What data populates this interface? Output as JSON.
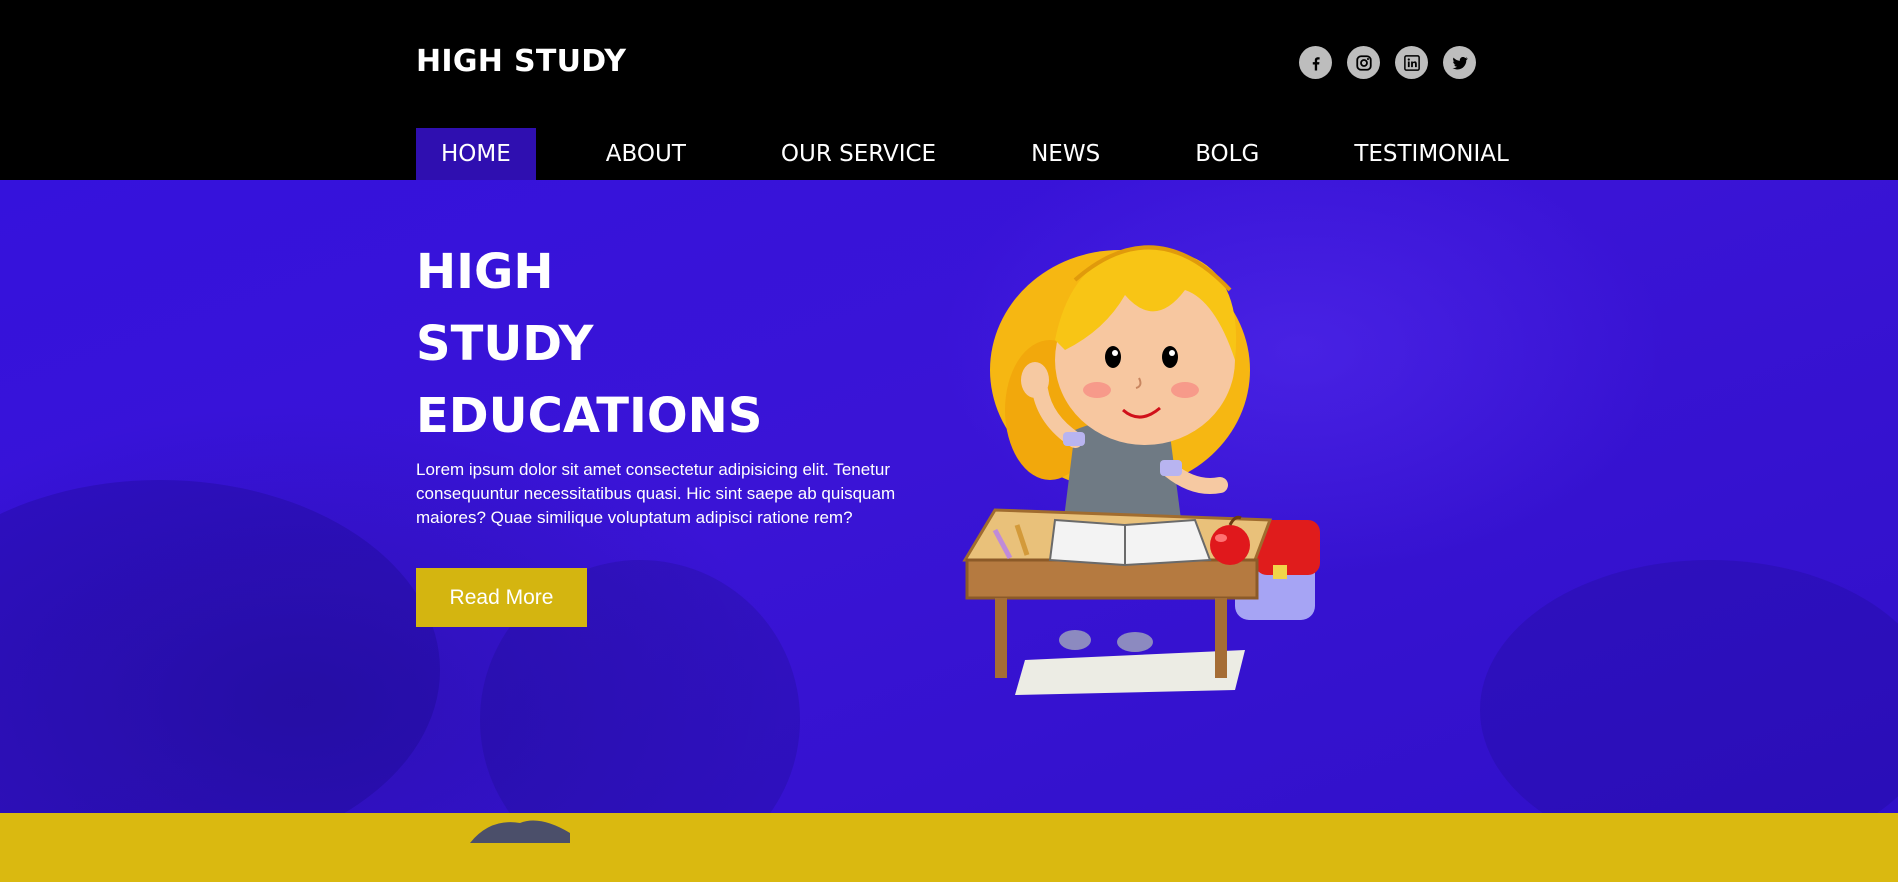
{
  "header": {
    "logo": "HIGH STUDY",
    "socials": [
      {
        "name": "facebook-icon"
      },
      {
        "name": "instagram-icon"
      },
      {
        "name": "linkedin-icon"
      },
      {
        "name": "twitter-icon"
      }
    ]
  },
  "nav": {
    "items": [
      {
        "label": "HOME",
        "active": true
      },
      {
        "label": "ABOUT"
      },
      {
        "label": "OUR SERVICE"
      },
      {
        "label": "NEWS"
      },
      {
        "label": "BOLG"
      },
      {
        "label": "TESTIMONIAL"
      }
    ]
  },
  "hero": {
    "title_lines": [
      "HIGH",
      "STUDY",
      "EDUCATIONS"
    ],
    "text": "Lorem ipsum dolor sit amet consectetur adipisicing elit. Tenetur consequuntur necessitatibus quasi. Hic sint saepe ab quisquam maiores? Quae similique voluptatum adipisci ratione rem?",
    "button": "Read More"
  },
  "colors": {
    "header_bg": "#000000",
    "nav_active_bg": "#2f0fb0",
    "hero_bg": "#3512dc",
    "button_bg": "#d4b510",
    "band_bg": "#dab910",
    "social_icon_bg": "#bdbdbd"
  }
}
